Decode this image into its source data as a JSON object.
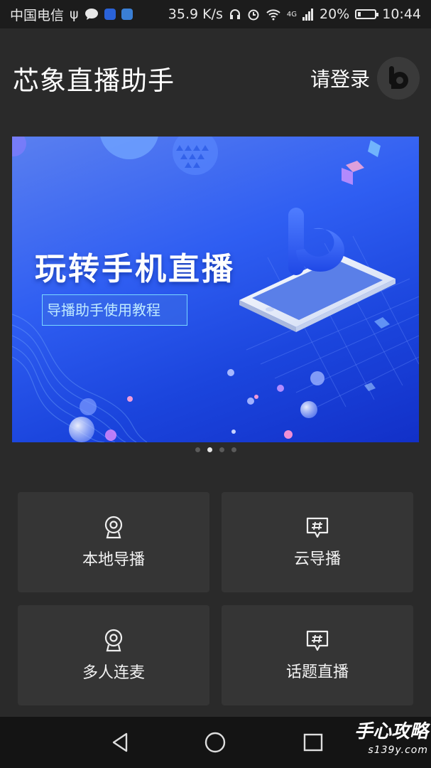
{
  "status_bar": {
    "carrier": "中国电信",
    "speed": "35.9 K/s",
    "network": "4G",
    "battery": "20%",
    "battery_level": 0.2,
    "time": "10:44"
  },
  "header": {
    "title": "芯象直播助手",
    "login_label": "请登录",
    "avatar_icon": "b-logo-icon"
  },
  "banner": {
    "title": "玩转手机直播",
    "subtitle": "导播助手使用教程",
    "slide_count": 4,
    "active_slide": 2
  },
  "menu": [
    {
      "label": "本地导播",
      "icon": "webcam-icon"
    },
    {
      "label": "云导播",
      "icon": "hashtag-bubble-icon"
    },
    {
      "label": "多人连麦",
      "icon": "webcam-icon"
    },
    {
      "label": "话题直播",
      "icon": "hashtag-bubble-icon"
    }
  ],
  "nav_bar": {
    "back_icon": "back-triangle-icon",
    "home_icon": "home-circle-icon",
    "recents_icon": "recents-square-icon"
  },
  "watermark": {
    "text": "手心攻略",
    "url": "s139y.com"
  },
  "colors": {
    "background": "#2a2a2a",
    "card": "#353535",
    "banner_blue": "#2f5ef2"
  }
}
